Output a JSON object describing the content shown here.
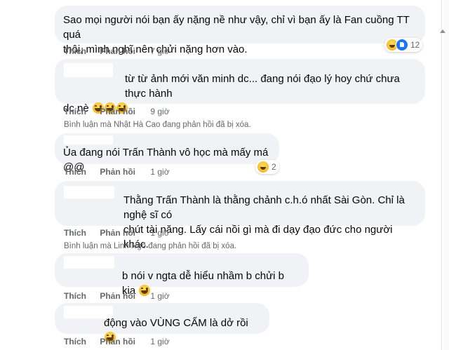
{
  "comments": [
    {
      "lines": [
        "Sao mọi người nói bạn ấy nặng nề như vậy, chỉ vì bạn ấy là Fan cuồng TT quá",
        "thôi, mình nghĩ nên chửi nặng hơn vào."
      ],
      "like": "Thích",
      "reply": "Phản hồi",
      "time": "7 giờ",
      "reaction_count": "12"
    },
    {
      "lines": [
        "từ từ ảnh mới văn minh dc... đang nói đạo lý hoy chứ chưa thực hành",
        "dc nè"
      ],
      "like": "Thích",
      "reply": "Phản hồi",
      "time": "9 giờ",
      "deleted_note": "Bình luận mà Nhật Hà Cao đang phản hồi đã bị xóa."
    },
    {
      "lines": [
        "Ủa đang nói Trấn Thành vô học mà mấy má @@"
      ],
      "like": "Thích",
      "reply": "Phản hồi",
      "time": "1 giờ",
      "reaction_count": "2"
    },
    {
      "lines": [
        "Thằng Trấn Thành là thằng chảnh c.h.ó nhất Sài Gòn. Chỉ là nghệ sĩ có",
        "chút tài năng. Lấy cái nồi gì mà đi dạy đạo đức cho người khác."
      ],
      "like": "Thích",
      "reply": "Phản hồi",
      "time": "1 giờ",
      "deleted_note": "Bình luận mà Linh Ngô đang phản hồi đã bị xóa."
    },
    {
      "lines": [
        "b nói v ngta dễ hiểu nhầm b chửi b kia"
      ],
      "like": "Thích",
      "reply": "Phản hồi",
      "time": "1 giờ"
    },
    {
      "lines": [
        "động vào VÙNG CẤM là dở rồi"
      ],
      "like": "Thích",
      "reply": "Phản hồi",
      "time": "1 giờ"
    }
  ],
  "colors": {
    "bubble": "#f0f2f5",
    "meta_text": "#65676b",
    "like_blue": "#1877f2",
    "haha_yellow": "#f7b928"
  }
}
